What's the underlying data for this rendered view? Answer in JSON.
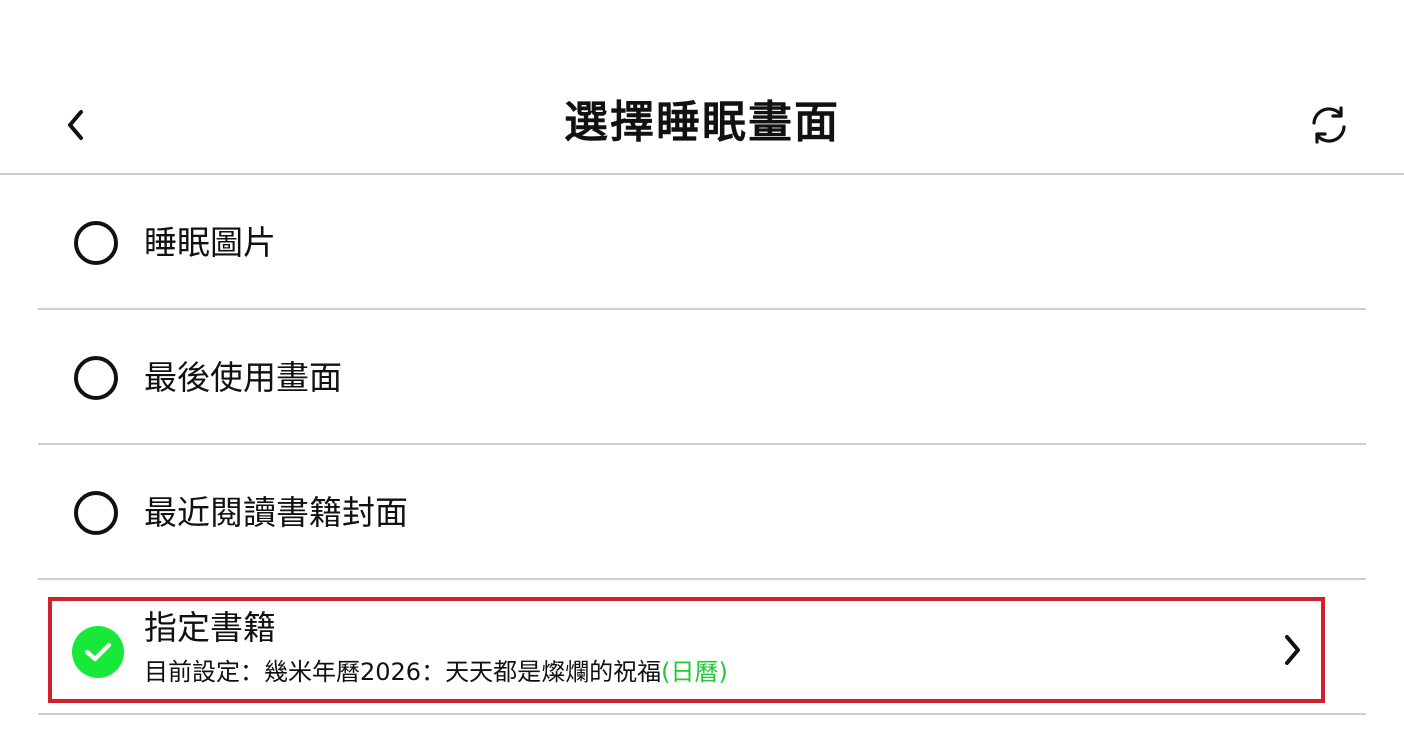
{
  "header": {
    "title": "選擇睡眠畫面",
    "back_icon": "chevron-left-icon",
    "refresh_icon": "refresh-icon"
  },
  "options": [
    {
      "label": "睡眠圖片",
      "selected": false
    },
    {
      "label": "最後使用畫面",
      "selected": false
    },
    {
      "label": "最近閱讀書籍封面",
      "selected": false
    },
    {
      "label": "指定書籍",
      "selected": true,
      "current_prefix": "目前設定：",
      "current_book": "幾米年曆2026：天天都是燦爛的祝福",
      "current_type": "(日曆)"
    }
  ],
  "colors": {
    "selected_green": "#17e83a",
    "type_green": "#22c93a",
    "highlight_red": "#d0202c",
    "divider": "#cfcfcf"
  }
}
